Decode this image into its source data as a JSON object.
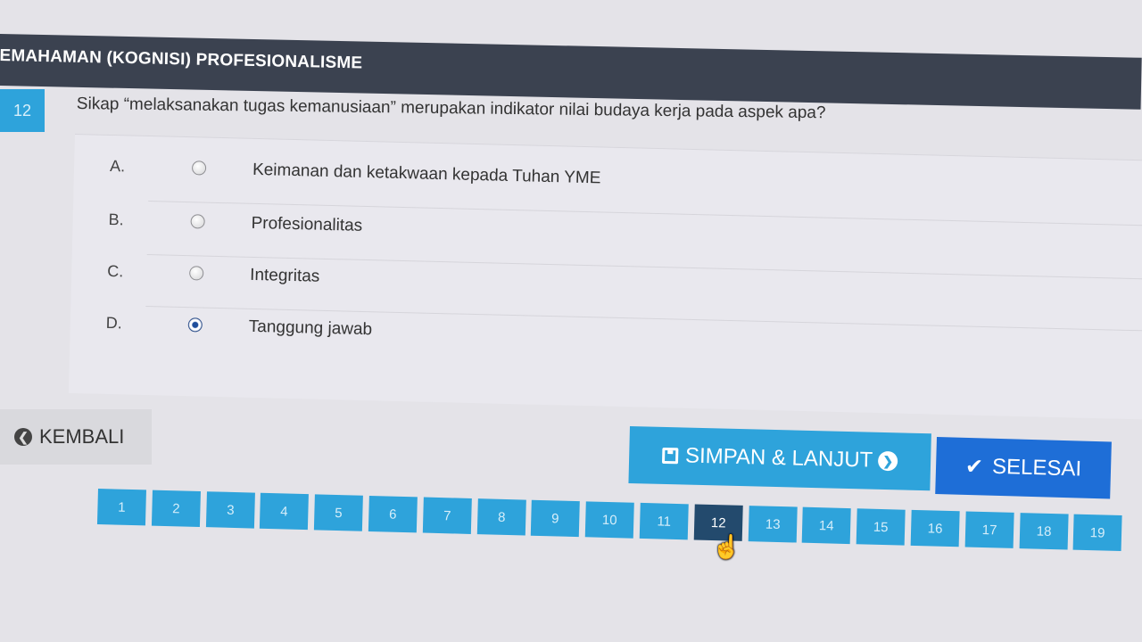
{
  "section": {
    "title": "EMAHAMAN (KOGNISI) PROFESIONALISME"
  },
  "question": {
    "number": "12",
    "text": "Sikap “melaksanakan tugas kemanusiaan” merupakan indikator nilai budaya kerja pada aspek apa?"
  },
  "options": [
    {
      "letter": "A.",
      "text": "Keimanan dan ketakwaan kepada Tuhan YME",
      "selected": false
    },
    {
      "letter": "B.",
      "text": "Profesionalitas",
      "selected": false
    },
    {
      "letter": "C.",
      "text": "Integritas",
      "selected": false
    },
    {
      "letter": "D.",
      "text": "Tanggung jawab",
      "selected": true
    }
  ],
  "buttons": {
    "back": "KEMBALI",
    "back_icon": "arrow-left-circle-icon",
    "save_next": "SIMPAN & LANJUT",
    "save_icon": "floppy-disk-icon",
    "next_icon": "arrow-right-circle-icon",
    "finish": "SELESAI",
    "finish_icon": "checkmark-icon"
  },
  "pagination": {
    "pages": [
      "1",
      "2",
      "3",
      "4",
      "5",
      "6",
      "7",
      "8",
      "9",
      "10",
      "11",
      "12",
      "13",
      "14",
      "15",
      "16",
      "17",
      "18",
      "19"
    ],
    "current": "12"
  },
  "colors": {
    "header_bg": "#3b4250",
    "primary": "#2ea3db",
    "finish": "#1e6ed7",
    "active_page": "#234a6d"
  }
}
